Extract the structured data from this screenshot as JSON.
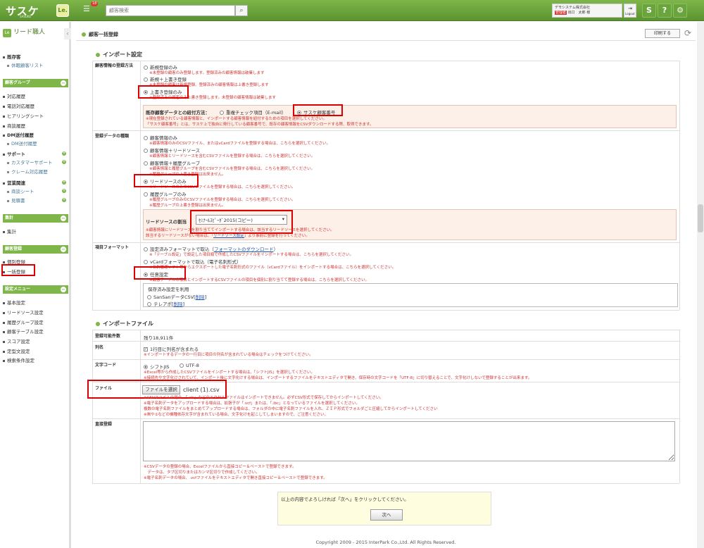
{
  "header": {
    "logo": "サスケ",
    "logo_sub": "SASUKE",
    "le_badge": "Le.",
    "notification_count": "18",
    "search_placeholder": "顧客検索",
    "company": "デモシステム株式会社",
    "role_badge": "管理者",
    "user_name": "出口　太郎 様",
    "logout": "Logout",
    "icon_s": "S",
    "icon_help": "?",
    "icon_gear": "⚙"
  },
  "sidebar": {
    "title": "リード職人",
    "items_top": [
      {
        "label": "既存客",
        "bold": true
      },
      {
        "label": "休眠顧客リスト",
        "sub": true
      }
    ],
    "sections": [
      {
        "title": "顧客グループ"
      },
      {
        "title": "集計"
      },
      {
        "title": "顧客登録"
      },
      {
        "title": "設定メニュー"
      }
    ],
    "group_items": [
      "対応履歴",
      "電話対応履歴",
      "ヒアリングシート",
      "商談履歴"
    ],
    "dm_label": "DM送付履歴",
    "dm_sub": "DM送付履歴",
    "support_label": "サポート",
    "support_subs": [
      "カスタマーサポート",
      "クレーム対応履歴"
    ],
    "sales_label": "営業関連",
    "sales_subs": [
      "商談シート",
      "見積書"
    ],
    "total_items": [
      "集計"
    ],
    "register_items": [
      "個別登録",
      "一括登録"
    ],
    "settings_items": [
      "基本設定",
      "リードソース設定",
      "履歴グループ設定",
      "顧客テーブル設定",
      "スコア設定",
      "定型文設定",
      "検索条件設定"
    ]
  },
  "page": {
    "title": "顧客一括登録",
    "print": "印刷する"
  },
  "import_settings": {
    "title": "インポート設定",
    "method_label": "顧客情報の登録方法",
    "methods": [
      {
        "label": "新規登録のみ",
        "note": "※未登録の顧客のみ登録します。登録済みの顧客情報は破棄します"
      },
      {
        "label": "新規＋上書き登録",
        "note": "※未登録の顧客は新規登録、登録済みの顧客情報は上書き登録します"
      },
      {
        "label": "上書き登録のみ",
        "note": "※登録済みの顧客のみ上書き登録します。未登録の顧客情報は破棄します"
      }
    ],
    "link_method_label": "既存顧客データとの紐付方法：",
    "link_options": [
      "重複チェック項目（E-mail）",
      "サスケ顧客番号"
    ],
    "link_note1": "※現在登録されている顧客情報と、インポートする顧客情報を紐付するための項目を選択してください。",
    "link_note2": "「サスケ顧客番号」とは、サスケ上で独自に発行している顧客番号で、既存の顧客情報をCSVダウンロードする際、取得できます。",
    "data_type_label": "登録データの種類",
    "data_types": [
      {
        "label": "顧客情報のみ",
        "note": "※顧客情報のみのCSVファイル、またはvCardファイルを登録する場合は、こちらを選択してください。"
      },
      {
        "label": "顧客情報＋リードソース",
        "note": "※顧客情報とリードソースを含むCSVファイルを登録する場合は、こちらを選択してください。"
      },
      {
        "label": "顧客情報＋履歴グループ",
        "note": "※顧客情報と履歴グループを含むCSVファイルを登録する場合は、こちらを選択してください。",
        "note2": "※履歴グループの上書き登録は出来ません。"
      },
      {
        "label": "リードソースのみ",
        "note": "※リードソースのみのCSVファイルを登録する場合は、こちらを選択してください。"
      },
      {
        "label": "履歴グループのみ",
        "note": "※履歴グループのみのCSVファイルを登録する場合は、こちらを選択してください。",
        "note2": "※履歴グループの上書き登録は出来ません。"
      }
    ],
    "lead_assign_label": "リードソースの割当",
    "lead_select_value": "ｾﾐﾅｰﾙｽﾋﾟｰﾀﾞ2015(コピー)",
    "lead_note1": "※顧客情報にリードソースを割り当ててインポートする場合は、該当するリードソースを選択してください。",
    "lead_note2_pre": "該当するリードソースがない場合は、",
    "lead_note2_link": "リードソース設定",
    "lead_note2_post": "より事前に登録を行ってください。",
    "format_label": "項目フォーマット",
    "formats": [
      {
        "label": "設定済みフォーマットで取込（",
        "link": "フォーマットのダウンロード",
        "after": "）",
        "note": "※「テーブル設定」で設定した項目順で作成したCSVファイルをインポートする場合は、こちらを選択してください。"
      },
      {
        "label": "vCardフォーマットで取込（電子名刺形式）",
        "note": "※名刺管理ソフト等からエクスポートした電子名刺形式のファイル（vCardファイル）をインポートする場合は、こちらを選択してください。"
      },
      {
        "label": "任意設定",
        "note": "※顧客テーブルの項目とインポートするCSVファイルの項目を個別に割り当てて登録する場合は、こちらを選択してください。"
      }
    ],
    "saved_label": "保存済み設定を利用",
    "saved_items": [
      {
        "label": "SanSanデータCSV",
        "del": "削除"
      },
      {
        "label": "テレアポ",
        "del": "削除"
      }
    ]
  },
  "import_file": {
    "title": "インポートファイル",
    "count_label": "登録可能件数",
    "count_value": "残り18,911件",
    "header_label": "列名",
    "header_check": "1行目に列名が含まれる",
    "header_note": "※インポートするデータの一行目に項目の列名が含まれている場合はチェックをつけてください。",
    "encoding_label": "文字コード",
    "encodings": [
      "シフトJIS",
      "UTF-8"
    ],
    "enc_note1": "※Excel等から作成したCSVファイルをインポートする場合は、「シフトJIS」を選択してください。",
    "enc_note2": "※接続先や文字化けされていて、インポート後に文字化けする場合は、インポートするファイルをテキストエディタで開き、保存時の文字コードを「UTF-8」に切り替えることで、文字化けしないで登録することが出来ます。",
    "file_label": "ファイル",
    "file_button": "ファイルを選択",
    "file_name": "client (1).csv",
    "file_notes": [
      "※CSVファイルの場合、「.xls」などのエクセルファイルはインポートできません。必ずCSV形式で保存してからインポートしてください。",
      "※電子名刺データをアップロードする場合は、拡張子が「.vcf」または、「.ibc」となっているファイルを選択してください。",
      "複数の電子名刺ファイルをまとめてアップロードする場合は、フォルダの中に電子名刺ファイルを入れ、ＺＩＰ形式でフォルダごと圧縮してからインポートしてください",
      "※㈱や①などの機種依存文字が含まれている場合、文字化けを起こしてしまいますので、ご注意ください。"
    ],
    "direct_label": "直接登録",
    "direct_notes": [
      "※CSVデータの登録の場合、Excelファイルから直接コピー＆ペーストで登録できます。",
      "　データは、タブ区切りまたはカンマ区切りで作成してください。",
      "※電子名刺データの場合、.vcfファイルをテキストエディタで開き直接コピー＆ペーストで登録できます。"
    ]
  },
  "confirm": {
    "message": "以上の内容でよろしければ「次へ」をクリックしてください。",
    "next": "次へ"
  },
  "footer": "Copyright 2009 - 2015 InterPark Co.,Ltd. All Rights Reserved."
}
